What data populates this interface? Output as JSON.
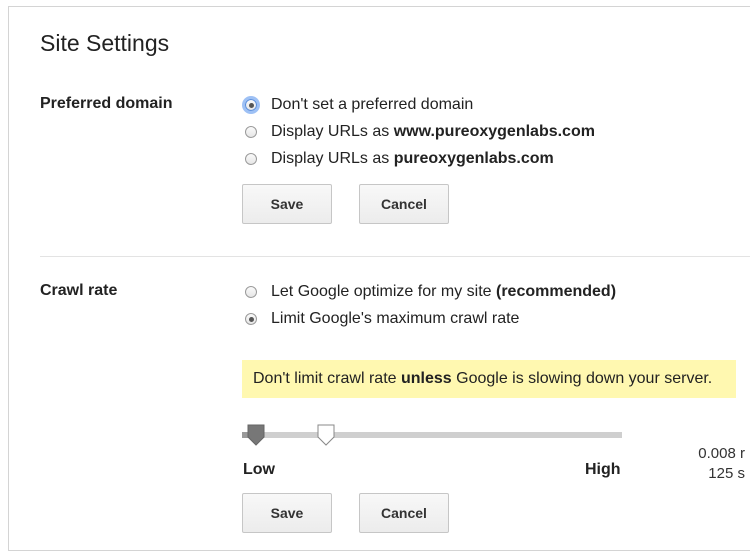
{
  "page": {
    "title": "Site Settings"
  },
  "preferred_domain": {
    "label": "Preferred domain",
    "options": [
      {
        "prefix": "Don't set a preferred domain",
        "bold": "",
        "checked": true
      },
      {
        "prefix": "Display URLs as ",
        "bold": "www.pureoxygenlabs.com",
        "checked": false
      },
      {
        "prefix": "Display URLs as ",
        "bold": "pureoxygenlabs.com",
        "checked": false
      }
    ],
    "save_label": "Save",
    "cancel_label": "Cancel"
  },
  "crawl_rate": {
    "label": "Crawl rate",
    "options": [
      {
        "prefix": "Let Google optimize for my site ",
        "bold": "(recommended)",
        "checked": false
      },
      {
        "prefix": "Limit Google's maximum crawl rate",
        "bold": "",
        "checked": true
      }
    ],
    "notice": {
      "before": "Don't limit crawl rate ",
      "bold": "unless",
      "after": " Google is slowing down your server."
    },
    "slider": {
      "low_label": "Low",
      "high_label": "High",
      "min_marker_fraction": 0.037,
      "value_fraction": 0.222
    },
    "readout": {
      "line1": "0.008 r",
      "line2": "125 s"
    },
    "save_label": "Save",
    "cancel_label": "Cancel"
  },
  "colors": {
    "notice_bg": "#fff8b0",
    "focus_ring": "#9ec1f5"
  }
}
